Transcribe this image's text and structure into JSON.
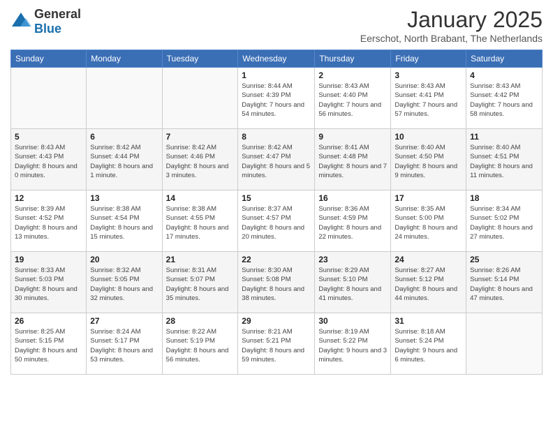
{
  "header": {
    "logo_general": "General",
    "logo_blue": "Blue",
    "month_title": "January 2025",
    "location": "Eerschot, North Brabant, The Netherlands"
  },
  "days_of_week": [
    "Sunday",
    "Monday",
    "Tuesday",
    "Wednesday",
    "Thursday",
    "Friday",
    "Saturday"
  ],
  "weeks": [
    [
      {
        "day": "",
        "info": ""
      },
      {
        "day": "",
        "info": ""
      },
      {
        "day": "",
        "info": ""
      },
      {
        "day": "1",
        "info": "Sunrise: 8:44 AM\nSunset: 4:39 PM\nDaylight: 7 hours and 54 minutes."
      },
      {
        "day": "2",
        "info": "Sunrise: 8:43 AM\nSunset: 4:40 PM\nDaylight: 7 hours and 56 minutes."
      },
      {
        "day": "3",
        "info": "Sunrise: 8:43 AM\nSunset: 4:41 PM\nDaylight: 7 hours and 57 minutes."
      },
      {
        "day": "4",
        "info": "Sunrise: 8:43 AM\nSunset: 4:42 PM\nDaylight: 7 hours and 58 minutes."
      }
    ],
    [
      {
        "day": "5",
        "info": "Sunrise: 8:43 AM\nSunset: 4:43 PM\nDaylight: 8 hours and 0 minutes."
      },
      {
        "day": "6",
        "info": "Sunrise: 8:42 AM\nSunset: 4:44 PM\nDaylight: 8 hours and 1 minute."
      },
      {
        "day": "7",
        "info": "Sunrise: 8:42 AM\nSunset: 4:46 PM\nDaylight: 8 hours and 3 minutes."
      },
      {
        "day": "8",
        "info": "Sunrise: 8:42 AM\nSunset: 4:47 PM\nDaylight: 8 hours and 5 minutes."
      },
      {
        "day": "9",
        "info": "Sunrise: 8:41 AM\nSunset: 4:48 PM\nDaylight: 8 hours and 7 minutes."
      },
      {
        "day": "10",
        "info": "Sunrise: 8:40 AM\nSunset: 4:50 PM\nDaylight: 8 hours and 9 minutes."
      },
      {
        "day": "11",
        "info": "Sunrise: 8:40 AM\nSunset: 4:51 PM\nDaylight: 8 hours and 11 minutes."
      }
    ],
    [
      {
        "day": "12",
        "info": "Sunrise: 8:39 AM\nSunset: 4:52 PM\nDaylight: 8 hours and 13 minutes."
      },
      {
        "day": "13",
        "info": "Sunrise: 8:38 AM\nSunset: 4:54 PM\nDaylight: 8 hours and 15 minutes."
      },
      {
        "day": "14",
        "info": "Sunrise: 8:38 AM\nSunset: 4:55 PM\nDaylight: 8 hours and 17 minutes."
      },
      {
        "day": "15",
        "info": "Sunrise: 8:37 AM\nSunset: 4:57 PM\nDaylight: 8 hours and 20 minutes."
      },
      {
        "day": "16",
        "info": "Sunrise: 8:36 AM\nSunset: 4:59 PM\nDaylight: 8 hours and 22 minutes."
      },
      {
        "day": "17",
        "info": "Sunrise: 8:35 AM\nSunset: 5:00 PM\nDaylight: 8 hours and 24 minutes."
      },
      {
        "day": "18",
        "info": "Sunrise: 8:34 AM\nSunset: 5:02 PM\nDaylight: 8 hours and 27 minutes."
      }
    ],
    [
      {
        "day": "19",
        "info": "Sunrise: 8:33 AM\nSunset: 5:03 PM\nDaylight: 8 hours and 30 minutes."
      },
      {
        "day": "20",
        "info": "Sunrise: 8:32 AM\nSunset: 5:05 PM\nDaylight: 8 hours and 32 minutes."
      },
      {
        "day": "21",
        "info": "Sunrise: 8:31 AM\nSunset: 5:07 PM\nDaylight: 8 hours and 35 minutes."
      },
      {
        "day": "22",
        "info": "Sunrise: 8:30 AM\nSunset: 5:08 PM\nDaylight: 8 hours and 38 minutes."
      },
      {
        "day": "23",
        "info": "Sunrise: 8:29 AM\nSunset: 5:10 PM\nDaylight: 8 hours and 41 minutes."
      },
      {
        "day": "24",
        "info": "Sunrise: 8:27 AM\nSunset: 5:12 PM\nDaylight: 8 hours and 44 minutes."
      },
      {
        "day": "25",
        "info": "Sunrise: 8:26 AM\nSunset: 5:14 PM\nDaylight: 8 hours and 47 minutes."
      }
    ],
    [
      {
        "day": "26",
        "info": "Sunrise: 8:25 AM\nSunset: 5:15 PM\nDaylight: 8 hours and 50 minutes."
      },
      {
        "day": "27",
        "info": "Sunrise: 8:24 AM\nSunset: 5:17 PM\nDaylight: 8 hours and 53 minutes."
      },
      {
        "day": "28",
        "info": "Sunrise: 8:22 AM\nSunset: 5:19 PM\nDaylight: 8 hours and 56 minutes."
      },
      {
        "day": "29",
        "info": "Sunrise: 8:21 AM\nSunset: 5:21 PM\nDaylight: 8 hours and 59 minutes."
      },
      {
        "day": "30",
        "info": "Sunrise: 8:19 AM\nSunset: 5:22 PM\nDaylight: 9 hours and 3 minutes."
      },
      {
        "day": "31",
        "info": "Sunrise: 8:18 AM\nSunset: 5:24 PM\nDaylight: 9 hours and 6 minutes."
      },
      {
        "day": "",
        "info": ""
      }
    ]
  ]
}
